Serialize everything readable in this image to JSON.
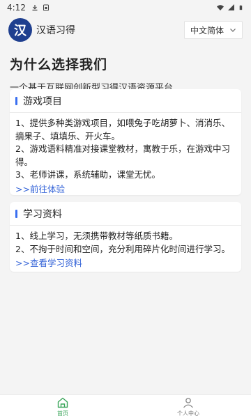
{
  "status_bar": {
    "time": "4:12"
  },
  "header": {
    "logo_glyph": "汉",
    "app_name": "汉语习得",
    "language_select": {
      "value": "中文简体"
    }
  },
  "hero": {
    "title": "为什么选择我们",
    "subtitle": "一个基于互联网创新型习得汉语资源平台"
  },
  "cards": [
    {
      "title": "游戏项目",
      "lines": [
        "1、提供多种类游戏项目，如喂兔子吃胡萝卜、消消乐、摘果子、填填乐、开火车。",
        "2、游戏语料精准对接课堂教材，寓教于乐，在游戏中习得。",
        "3、老师讲课，系统辅助，课堂无忧。"
      ],
      "link": ">>前往体验"
    },
    {
      "title": "学习资料",
      "lines": [
        "1、线上学习，无须携带教材等纸质书籍。",
        "2、不拘于时间和空间，充分利用碎片化时间进行学习。"
      ],
      "link": ">>查看学习资料"
    }
  ],
  "tabbar": {
    "home": "首页",
    "me": "个人中心"
  },
  "colors": {
    "accent": "#3a6ff0",
    "link": "#3564d8",
    "tab_active": "#3aa55a",
    "logo_bg": "#1f3f8f"
  }
}
